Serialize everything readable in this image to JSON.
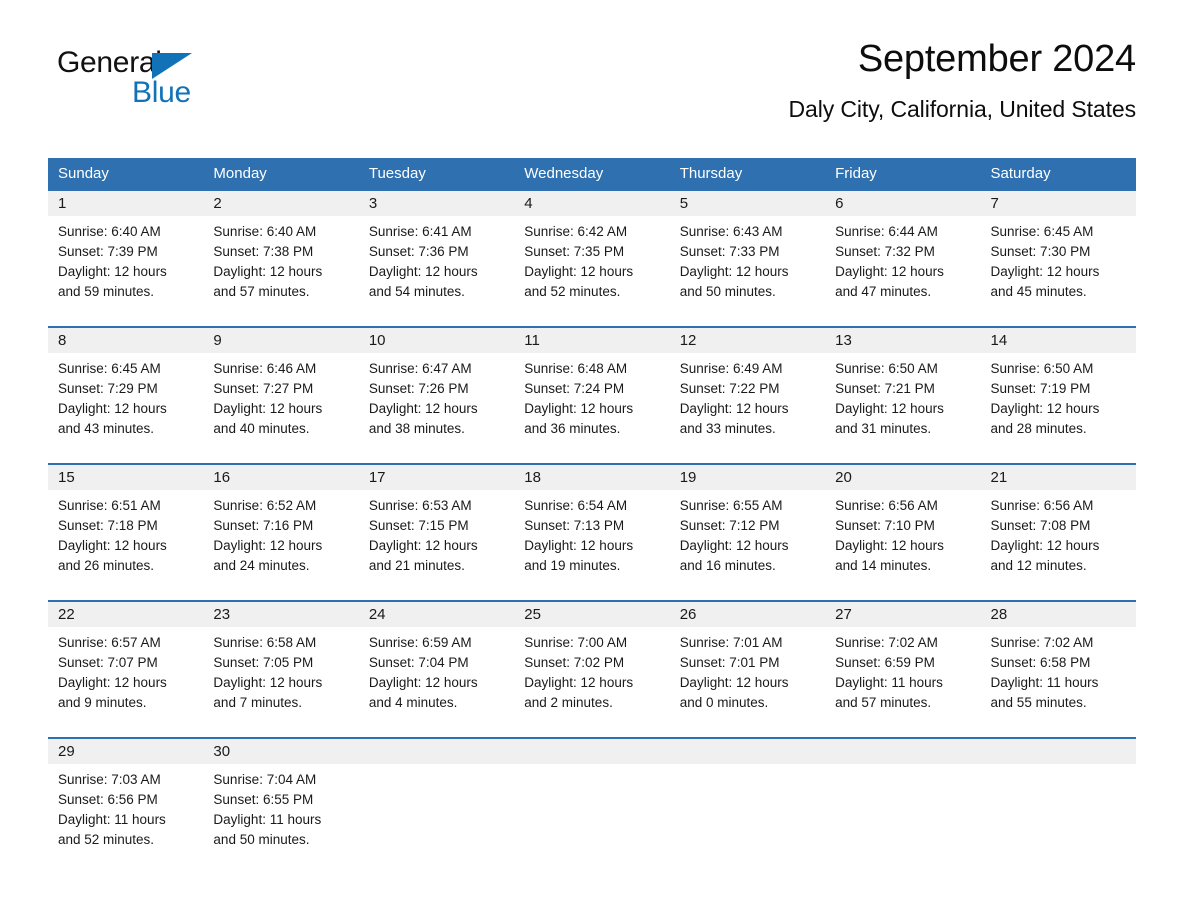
{
  "brand": {
    "name_part1": "General",
    "name_part2": "Blue"
  },
  "header": {
    "title": "September 2024",
    "subtitle": "Daly City, California, United States"
  },
  "colors": {
    "header_blue": "#2e70b0",
    "daynum_band": "#f0f0f0",
    "brand_blue": "#1272b8",
    "text": "#1a1a1a"
  },
  "weekdays": [
    "Sunday",
    "Monday",
    "Tuesday",
    "Wednesday",
    "Thursday",
    "Friday",
    "Saturday"
  ],
  "weeks": [
    {
      "days": [
        {
          "num": "1",
          "l1": "Sunrise: 6:40 AM",
          "l2": "Sunset: 7:39 PM",
          "l3": "Daylight: 12 hours",
          "l4": "and 59 minutes."
        },
        {
          "num": "2",
          "l1": "Sunrise: 6:40 AM",
          "l2": "Sunset: 7:38 PM",
          "l3": "Daylight: 12 hours",
          "l4": "and 57 minutes."
        },
        {
          "num": "3",
          "l1": "Sunrise: 6:41 AM",
          "l2": "Sunset: 7:36 PM",
          "l3": "Daylight: 12 hours",
          "l4": "and 54 minutes."
        },
        {
          "num": "4",
          "l1": "Sunrise: 6:42 AM",
          "l2": "Sunset: 7:35 PM",
          "l3": "Daylight: 12 hours",
          "l4": "and 52 minutes."
        },
        {
          "num": "5",
          "l1": "Sunrise: 6:43 AM",
          "l2": "Sunset: 7:33 PM",
          "l3": "Daylight: 12 hours",
          "l4": "and 50 minutes."
        },
        {
          "num": "6",
          "l1": "Sunrise: 6:44 AM",
          "l2": "Sunset: 7:32 PM",
          "l3": "Daylight: 12 hours",
          "l4": "and 47 minutes."
        },
        {
          "num": "7",
          "l1": "Sunrise: 6:45 AM",
          "l2": "Sunset: 7:30 PM",
          "l3": "Daylight: 12 hours",
          "l4": "and 45 minutes."
        }
      ]
    },
    {
      "days": [
        {
          "num": "8",
          "l1": "Sunrise: 6:45 AM",
          "l2": "Sunset: 7:29 PM",
          "l3": "Daylight: 12 hours",
          "l4": "and 43 minutes."
        },
        {
          "num": "9",
          "l1": "Sunrise: 6:46 AM",
          "l2": "Sunset: 7:27 PM",
          "l3": "Daylight: 12 hours",
          "l4": "and 40 minutes."
        },
        {
          "num": "10",
          "l1": "Sunrise: 6:47 AM",
          "l2": "Sunset: 7:26 PM",
          "l3": "Daylight: 12 hours",
          "l4": "and 38 minutes."
        },
        {
          "num": "11",
          "l1": "Sunrise: 6:48 AM",
          "l2": "Sunset: 7:24 PM",
          "l3": "Daylight: 12 hours",
          "l4": "and 36 minutes."
        },
        {
          "num": "12",
          "l1": "Sunrise: 6:49 AM",
          "l2": "Sunset: 7:22 PM",
          "l3": "Daylight: 12 hours",
          "l4": "and 33 minutes."
        },
        {
          "num": "13",
          "l1": "Sunrise: 6:50 AM",
          "l2": "Sunset: 7:21 PM",
          "l3": "Daylight: 12 hours",
          "l4": "and 31 minutes."
        },
        {
          "num": "14",
          "l1": "Sunrise: 6:50 AM",
          "l2": "Sunset: 7:19 PM",
          "l3": "Daylight: 12 hours",
          "l4": "and 28 minutes."
        }
      ]
    },
    {
      "days": [
        {
          "num": "15",
          "l1": "Sunrise: 6:51 AM",
          "l2": "Sunset: 7:18 PM",
          "l3": "Daylight: 12 hours",
          "l4": "and 26 minutes."
        },
        {
          "num": "16",
          "l1": "Sunrise: 6:52 AM",
          "l2": "Sunset: 7:16 PM",
          "l3": "Daylight: 12 hours",
          "l4": "and 24 minutes."
        },
        {
          "num": "17",
          "l1": "Sunrise: 6:53 AM",
          "l2": "Sunset: 7:15 PM",
          "l3": "Daylight: 12 hours",
          "l4": "and 21 minutes."
        },
        {
          "num": "18",
          "l1": "Sunrise: 6:54 AM",
          "l2": "Sunset: 7:13 PM",
          "l3": "Daylight: 12 hours",
          "l4": "and 19 minutes."
        },
        {
          "num": "19",
          "l1": "Sunrise: 6:55 AM",
          "l2": "Sunset: 7:12 PM",
          "l3": "Daylight: 12 hours",
          "l4": "and 16 minutes."
        },
        {
          "num": "20",
          "l1": "Sunrise: 6:56 AM",
          "l2": "Sunset: 7:10 PM",
          "l3": "Daylight: 12 hours",
          "l4": "and 14 minutes."
        },
        {
          "num": "21",
          "l1": "Sunrise: 6:56 AM",
          "l2": "Sunset: 7:08 PM",
          "l3": "Daylight: 12 hours",
          "l4": "and 12 minutes."
        }
      ]
    },
    {
      "days": [
        {
          "num": "22",
          "l1": "Sunrise: 6:57 AM",
          "l2": "Sunset: 7:07 PM",
          "l3": "Daylight: 12 hours",
          "l4": "and 9 minutes."
        },
        {
          "num": "23",
          "l1": "Sunrise: 6:58 AM",
          "l2": "Sunset: 7:05 PM",
          "l3": "Daylight: 12 hours",
          "l4": "and 7 minutes."
        },
        {
          "num": "24",
          "l1": "Sunrise: 6:59 AM",
          "l2": "Sunset: 7:04 PM",
          "l3": "Daylight: 12 hours",
          "l4": "and 4 minutes."
        },
        {
          "num": "25",
          "l1": "Sunrise: 7:00 AM",
          "l2": "Sunset: 7:02 PM",
          "l3": "Daylight: 12 hours",
          "l4": "and 2 minutes."
        },
        {
          "num": "26",
          "l1": "Sunrise: 7:01 AM",
          "l2": "Sunset: 7:01 PM",
          "l3": "Daylight: 12 hours",
          "l4": "and 0 minutes."
        },
        {
          "num": "27",
          "l1": "Sunrise: 7:02 AM",
          "l2": "Sunset: 6:59 PM",
          "l3": "Daylight: 11 hours",
          "l4": "and 57 minutes."
        },
        {
          "num": "28",
          "l1": "Sunrise: 7:02 AM",
          "l2": "Sunset: 6:58 PM",
          "l3": "Daylight: 11 hours",
          "l4": "and 55 minutes."
        }
      ]
    },
    {
      "days": [
        {
          "num": "29",
          "l1": "Sunrise: 7:03 AM",
          "l2": "Sunset: 6:56 PM",
          "l3": "Daylight: 11 hours",
          "l4": "and 52 minutes."
        },
        {
          "num": "30",
          "l1": "Sunrise: 7:04 AM",
          "l2": "Sunset: 6:55 PM",
          "l3": "Daylight: 11 hours",
          "l4": "and 50 minutes."
        },
        {
          "num": "",
          "l1": "",
          "l2": "",
          "l3": "",
          "l4": ""
        },
        {
          "num": "",
          "l1": "",
          "l2": "",
          "l3": "",
          "l4": ""
        },
        {
          "num": "",
          "l1": "",
          "l2": "",
          "l3": "",
          "l4": ""
        },
        {
          "num": "",
          "l1": "",
          "l2": "",
          "l3": "",
          "l4": ""
        },
        {
          "num": "",
          "l1": "",
          "l2": "",
          "l3": "",
          "l4": ""
        }
      ]
    }
  ]
}
